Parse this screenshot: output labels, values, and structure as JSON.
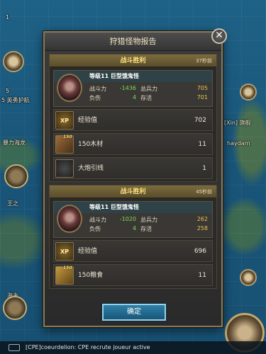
{
  "map": {
    "labels": [
      {
        "id": "label-1",
        "text": "1"
      },
      {
        "id": "label-2",
        "text": "5"
      },
      {
        "id": "label-3",
        "text": "5 英勇护航"
      },
      {
        "id": "label-4",
        "text": "暴力海龙"
      },
      {
        "id": "label-5",
        "text": "[Xin] 旗舰"
      },
      {
        "id": "label-6",
        "text": "haydam"
      },
      {
        "id": "label-7",
        "text": "王之"
      },
      {
        "id": "label-8",
        "text": "海主"
      }
    ]
  },
  "dialog": {
    "title": "狩猎怪物报告",
    "close_symbol": "✕",
    "confirm_label": "确定"
  },
  "reports": [
    {
      "header": "战斗胜利",
      "time": "37秒前",
      "monster": {
        "name": "等级11 巨型饿鬼怪",
        "power_label": "战斗力",
        "power_change": "-1436",
        "troops_label": "总兵力",
        "troops_value": "705",
        "wounded_label": "负伤",
        "wounded_value": "4",
        "alive_label": "存活",
        "alive_value": "701"
      },
      "rewards": [
        {
          "icon": "exp-icon",
          "icon_text": "XP",
          "name": "经验值",
          "qty": "702"
        },
        {
          "icon": "wood-icon",
          "icon_text": "",
          "badge": "150",
          "name": "150木材",
          "qty": "11"
        },
        {
          "icon": "cannon-fuse-icon",
          "icon_text": "",
          "name": "大炮引线",
          "qty": "1"
        }
      ]
    },
    {
      "header": "战斗胜利",
      "time": "45秒前",
      "monster": {
        "name": "等级11 巨型饿鬼怪",
        "power_label": "战斗力",
        "power_change": "-1020",
        "troops_label": "总兵力",
        "troops_value": "262",
        "wounded_label": "负伤",
        "wounded_value": "4",
        "alive_label": "存活",
        "alive_value": "258"
      },
      "rewards": [
        {
          "icon": "exp-icon",
          "icon_text": "XP",
          "name": "经验值",
          "qty": "696"
        },
        {
          "icon": "grain-icon",
          "icon_text": "",
          "badge": "150",
          "name": "150粮食",
          "qty": "11"
        }
      ]
    }
  ],
  "chat": {
    "text": "[CPE]coeurdelion: CPE recrute  joueur active"
  },
  "colors": {
    "accent_gold": "#ffe07a",
    "positive_green": "#7ed957",
    "value_yellow": "#e6c34e",
    "confirm_blue": "#2e7fa8"
  }
}
